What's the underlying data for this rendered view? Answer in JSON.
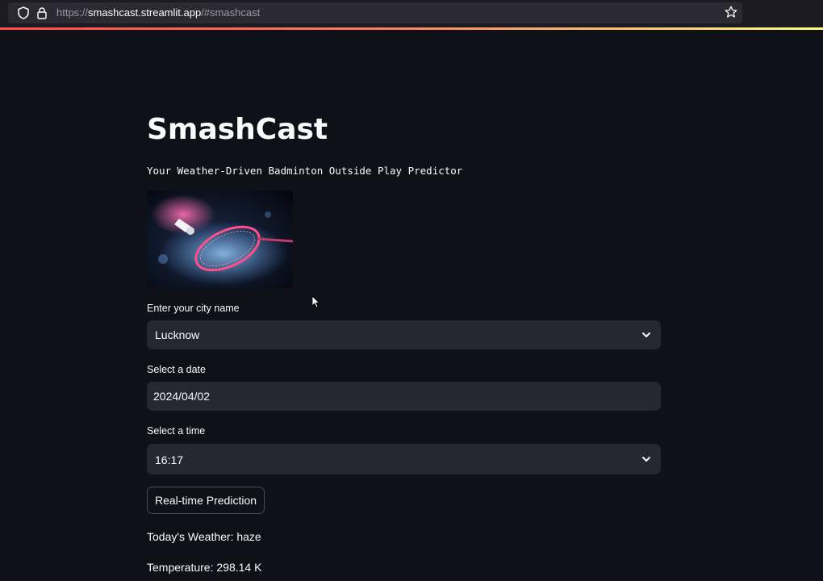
{
  "browser": {
    "url_prefix": "https://",
    "url_host": "smashcast.streamlit.app",
    "url_path": "/#smashcast"
  },
  "header": {
    "title": "SmashCast",
    "subtitle": "Your Weather-Driven Badminton Outside Play Predictor"
  },
  "hero_image": {
    "alt": "badminton-shuttlecock-racket-image"
  },
  "form": {
    "city_label": "Enter your city name",
    "city_value": "Lucknow",
    "date_label": "Select a date",
    "date_value": "2024/04/02",
    "time_label": "Select a time",
    "time_value": "16:17"
  },
  "actions": {
    "predict_label": "Real-time Prediction"
  },
  "results": {
    "weather": "Today's Weather: haze",
    "temperature": "Temperature: 298.14 K"
  },
  "colors": {
    "background": "#0e1117",
    "field_bg": "#262730",
    "text": "#fafafa",
    "accent_start": "#ff4b4b",
    "accent_end": "#fffd80"
  }
}
